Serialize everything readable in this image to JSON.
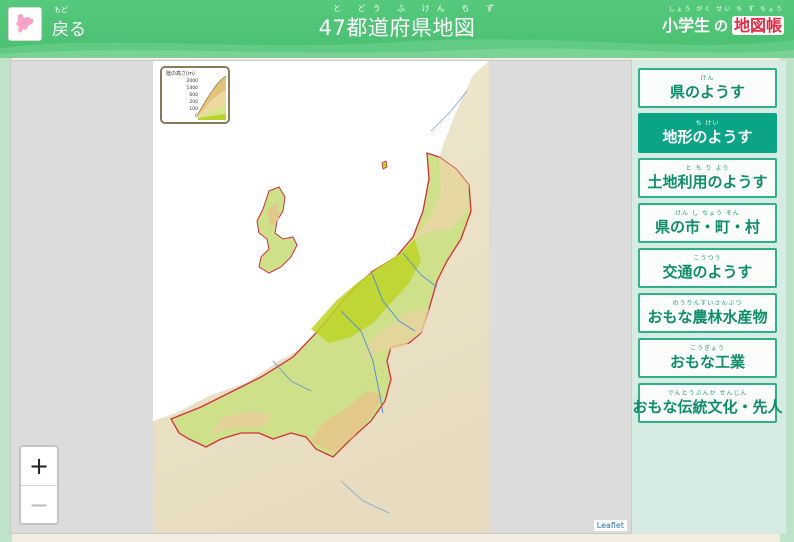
{
  "header": {
    "back_label": "戻る",
    "back_ruby": "もど",
    "title": "47都道府県地図",
    "title_ruby": "と どう ふ けん ち ず",
    "brand_ruby": "しょう がく せい    ち ず ちょう",
    "brand_part1": "小学生",
    "brand_part2": "の",
    "brand_part3": "地図帳"
  },
  "legend": {
    "title": "陸の高さ(m)",
    "levels": [
      "2000",
      "1400",
      "600",
      "200",
      "100",
      "0"
    ]
  },
  "zoom": {
    "in_label": "+",
    "out_label": "−"
  },
  "attribution": "Leaflet",
  "menu": [
    {
      "ruby": "けん",
      "label": "県のようす",
      "active": false
    },
    {
      "ruby": "ち けい",
      "label": "地形のようす",
      "active": true
    },
    {
      "ruby": "と ち り よう",
      "label": "土地利用のようす",
      "active": false
    },
    {
      "ruby": "けん  し  ちょう  そん",
      "label": "県の市・町・村",
      "active": false
    },
    {
      "ruby": "こうつう",
      "label": "交通のようす",
      "active": false
    },
    {
      "ruby": "のうりんすいさんぶつ",
      "label": "おもな農林水産物",
      "active": false
    },
    {
      "ruby": "こうぎょう",
      "label": "おもな工業",
      "active": false
    },
    {
      "ruby": "でんとうぶんか  せんじん",
      "label": "おもな伝統文化・先人",
      "active": false
    }
  ],
  "colors": {
    "header_green": "#49bf70",
    "menu_border": "#2fb08b",
    "menu_active": "#0aa486",
    "prefecture_border": "#d0303a",
    "sea": "#ffffff",
    "lowland": "#c3d82a"
  }
}
